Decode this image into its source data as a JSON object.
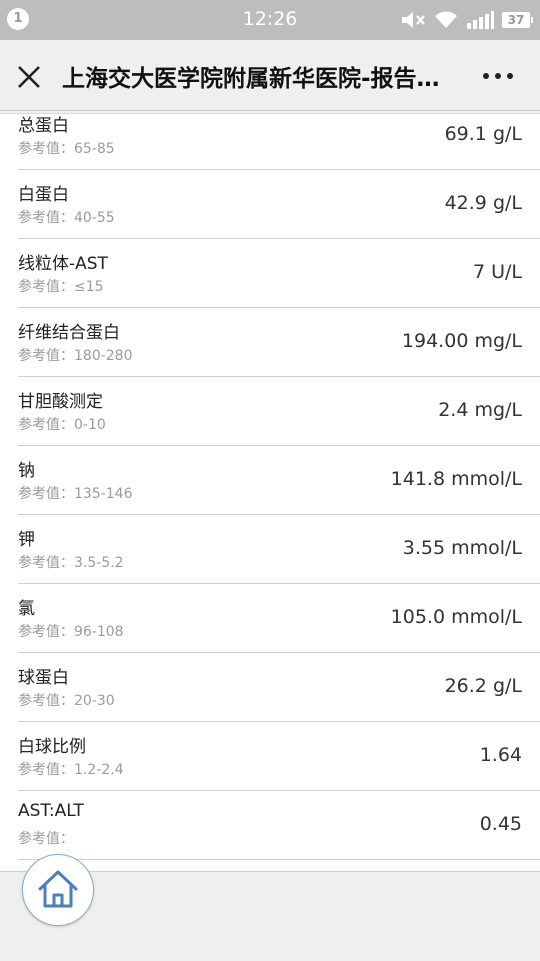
{
  "status_bar": {
    "notification_count": "1",
    "time": "12:26",
    "battery": "37",
    "icons": [
      "mute-icon",
      "wifi-icon",
      "signal-icon",
      "battery-icon"
    ]
  },
  "header": {
    "title": "上海交大医学院附属新华医院-报告查询"
  },
  "results": [
    {
      "name": "总蛋白",
      "ref": "参考值：65-85",
      "value": "69.1 g/L"
    },
    {
      "name": "白蛋白",
      "ref": "参考值：40-55",
      "value": "42.9 g/L"
    },
    {
      "name": "线粒体-AST",
      "ref": "参考值：≤15",
      "value": "7 U/L"
    },
    {
      "name": "纤维结合蛋白",
      "ref": "参考值：180-280",
      "value": "194.00 mg/L"
    },
    {
      "name": "甘胆酸测定",
      "ref": "参考值：0-10",
      "value": "2.4 mg/L"
    },
    {
      "name": "钠",
      "ref": "参考值：135-146",
      "value": "141.8 mmol/L"
    },
    {
      "name": "钾",
      "ref": "参考值：3.5-5.2",
      "value": "3.55 mmol/L"
    },
    {
      "name": "氯",
      "ref": "参考值：96-108",
      "value": "105.0 mmol/L"
    },
    {
      "name": "球蛋白",
      "ref": "参考值：20-30",
      "value": "26.2 g/L"
    },
    {
      "name": "白球比例",
      "ref": "参考值：1.2-2.4",
      "value": "1.64"
    },
    {
      "name": "AST:ALT",
      "ref": "参考值：",
      "value": "0.45"
    }
  ],
  "colors": {
    "status_bar": "#bdbdbd",
    "accent_blue": "#4a7fbd"
  }
}
